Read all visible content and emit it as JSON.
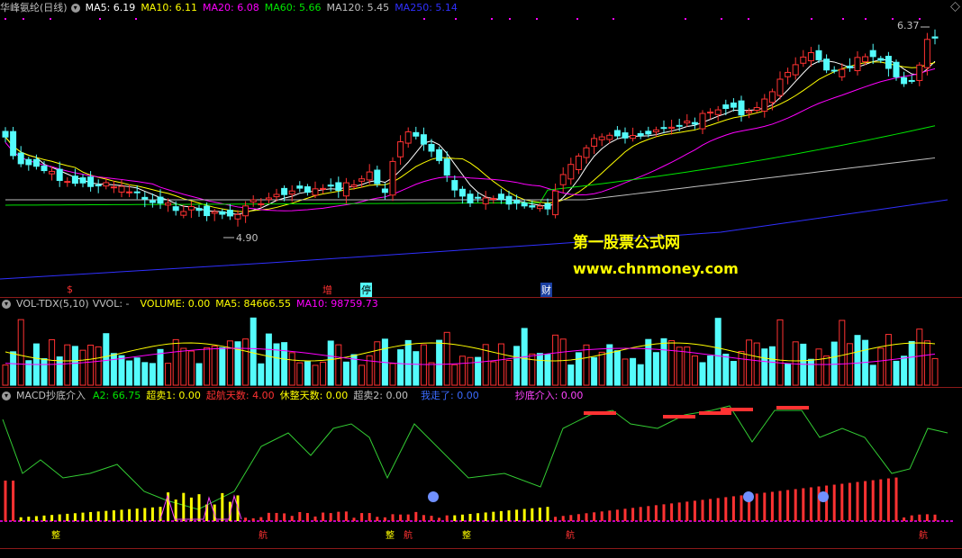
{
  "main": {
    "title": "华峰氨纶(日线)",
    "ma5": "MA5: 6.19",
    "ma10": "MA10: 6.11",
    "ma20": "MA20: 6.08",
    "ma60": "MA60: 5.66",
    "ma120": "MA120: 5.45",
    "ma250": "MA250: 5.14",
    "high_label": "6.37",
    "low_label": "4.90",
    "markers": [
      "$",
      "增",
      "停",
      "财"
    ]
  },
  "watermark": {
    "line1": "第一股票公式网",
    "line2": "www.chnmoney.com"
  },
  "volume": {
    "title": "VOL-TDX(5,10)",
    "vvol": "VVOL: -",
    "vol": "VOLUME: 0.00",
    "ma5": "MA5: 84666.55",
    "ma10": "MA10: 98759.73"
  },
  "macd": {
    "title": "MACD抄底介入",
    "a2": "A2: 66.75",
    "chaomai1": "超卖1: 0.00",
    "qihang": "起航天数: 4.00",
    "xiuzheng": "休整天数: 0.00",
    "chaomai2": "超卖2: 0.00",
    "zoule": "我走了: 0.00",
    "chaodi": "抄底介入: 0.00",
    "labels": [
      "整",
      "航",
      "整",
      "航",
      "整",
      "航",
      "航"
    ]
  },
  "colors": {
    "up": "#ff3232",
    "down": "#54fcfc",
    "ma5": "#ffffff",
    "ma10": "#ffff00",
    "ma20": "#ff00ff",
    "ma60": "#00e600",
    "ma120": "#c0c0c0",
    "ma250": "#3030ff"
  }
}
